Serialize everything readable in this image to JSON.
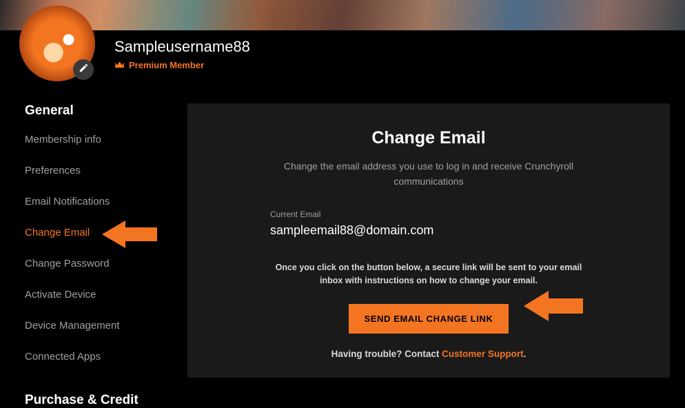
{
  "profile": {
    "username": "Sampleusername88",
    "member_label": "Premium Member"
  },
  "sidebar": {
    "section1": "General",
    "section2": "Purchase & Credit",
    "items": [
      {
        "label": "Membership info",
        "active": false
      },
      {
        "label": "Preferences",
        "active": false
      },
      {
        "label": "Email Notifications",
        "active": false
      },
      {
        "label": "Change Email",
        "active": true
      },
      {
        "label": "Change Password",
        "active": false
      },
      {
        "label": "Activate Device",
        "active": false
      },
      {
        "label": "Device Management",
        "active": false
      },
      {
        "label": "Connected Apps",
        "active": false
      }
    ]
  },
  "panel": {
    "title": "Change Email",
    "description": "Change the email address you use to log in and receive Crunchyroll communications",
    "field_label": "Current Email",
    "field_value": "sampleemail88@domain.com",
    "instructions": "Once you click on the button below, a secure link will be sent to your email inbox with instructions on how to change your email.",
    "button": "Send Email Change Link",
    "trouble_prefix": "Having trouble? Contact ",
    "trouble_link": "Customer Support",
    "trouble_suffix": "."
  }
}
